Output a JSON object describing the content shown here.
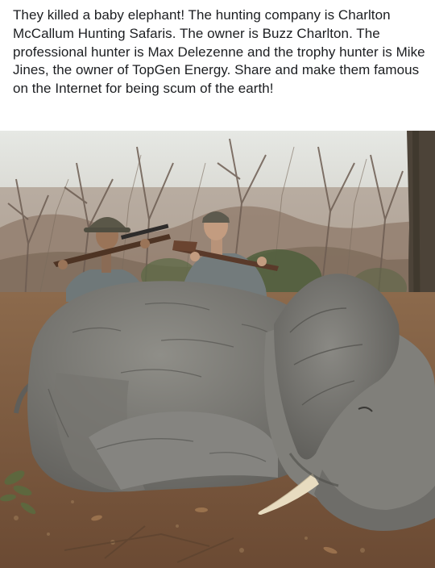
{
  "post": {
    "text": "They killed a baby elephant! The hunting company is Charlton McCallum Hunting Safaris. The owner is Buzz Charlton. The professional hunter is Max Delezenne and the trophy hunter is Mike Jines, the owner of TopGen Energy. Share and make them famous on the Internet for being scum of the earth!"
  },
  "colors": {
    "background": "#ffffff",
    "text": "#1c1e21",
    "sky": "#d9dcd6",
    "bush": "#8b7766",
    "elephant_skin": "#7f7f7a",
    "ground": "#7c5a3f",
    "shirt": "#737b7c",
    "tusk": "#e8dcc0"
  },
  "icons": [
    "hunting-photo"
  ]
}
